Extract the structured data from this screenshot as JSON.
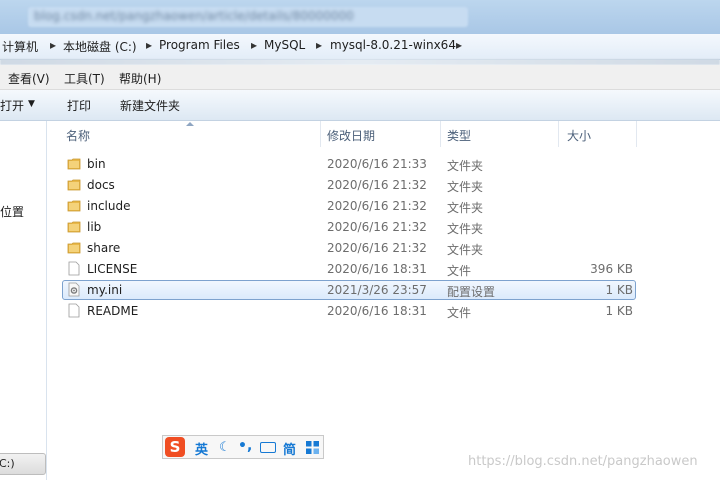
{
  "breadcrumb": {
    "items": [
      "计算机",
      "本地磁盘 (C:)",
      "Program Files",
      "MySQL",
      "mysql-8.0.21-winx64"
    ],
    "separator": "▸",
    "blurred_title": "blog.csdn.net/pangzhaowen/article/details/80000000"
  },
  "menu": {
    "items": [
      "查看(V)",
      "工具(T)",
      "帮助(H)"
    ]
  },
  "toolbar": {
    "open_label": "打开",
    "open_arrow": "▼",
    "print_label": "打印",
    "new_folder_label": "新建文件夹"
  },
  "nav": {
    "location_label": "位置",
    "drive_label": "C:)"
  },
  "columns": {
    "name": "名称",
    "date": "修改日期",
    "type": "类型",
    "size": "大小"
  },
  "files": [
    {
      "name": "bin",
      "date": "2020/6/16 21:33",
      "type": "文件夹",
      "size": "",
      "kind": "folder-icon"
    },
    {
      "name": "docs",
      "date": "2020/6/16 21:32",
      "type": "文件夹",
      "size": "",
      "kind": "folder-icon"
    },
    {
      "name": "include",
      "date": "2020/6/16 21:32",
      "type": "文件夹",
      "size": "",
      "kind": "folder-icon"
    },
    {
      "name": "lib",
      "date": "2020/6/16 21:32",
      "type": "文件夹",
      "size": "",
      "kind": "folder-icon"
    },
    {
      "name": "share",
      "date": "2020/6/16 21:32",
      "type": "文件夹",
      "size": "",
      "kind": "folder-icon"
    },
    {
      "name": "LICENSE",
      "date": "2020/6/16 18:31",
      "type": "文件",
      "size": "396 KB",
      "kind": "file-icon"
    },
    {
      "name": "my.ini",
      "date": "2021/3/26 23:57",
      "type": "配置设置",
      "size": "1 KB",
      "kind": "config-file-icon"
    },
    {
      "name": "README",
      "date": "2020/6/16 18:31",
      "type": "文件",
      "size": "1 KB",
      "kind": "file-icon"
    }
  ],
  "selected_file": "my.ini",
  "ime": {
    "logo": "S",
    "lang": "英",
    "punct": "•,",
    "mode": "简"
  },
  "watermark": "https://blog.csdn.net/pangzhaowen",
  "colors": {
    "selection_border": "#7da2ce",
    "folder": "#e8b84a",
    "ime_blue": "#1679d4",
    "ime_logo": "#f04e23"
  }
}
